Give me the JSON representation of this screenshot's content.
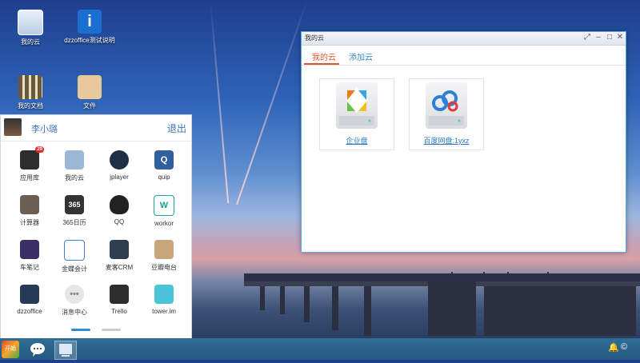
{
  "desktop_icons": [
    {
      "label": "我的云",
      "icon": "cloud-icon"
    },
    {
      "label": "dzzoffice测试说明",
      "icon": "info-icon"
    },
    {
      "label": "我的文档",
      "icon": "library-books-icon"
    },
    {
      "label": "文件",
      "icon": "folder-icon"
    }
  ],
  "start_menu": {
    "username": "李小璐",
    "logout": "退出",
    "apps": [
      {
        "label": "应用库",
        "icon": "app-store-icon",
        "color": "#2d2d2d",
        "badge": "29"
      },
      {
        "label": "我的云",
        "icon": "cloud-icon",
        "color": "#9bb7d6"
      },
      {
        "label": "jplayer",
        "icon": "speaker-icon",
        "color": "#1f2f45"
      },
      {
        "label": "quip",
        "icon": "quip-icon",
        "color": "#2f5f9e"
      },
      {
        "label": "计算器",
        "icon": "calculator-icon",
        "color": "#6b5e52"
      },
      {
        "label": "365日历",
        "icon": "calendar-icon",
        "color": "#333333"
      },
      {
        "label": "QQ",
        "icon": "penguin-icon",
        "color": "#222222"
      },
      {
        "label": "workor",
        "icon": "workor-icon",
        "color": "#1aa39a"
      },
      {
        "label": "车笔记",
        "icon": "notebook-icon",
        "color": "#3b2f66"
      },
      {
        "label": "金蝶会计",
        "icon": "kingdee-icon",
        "color": "#3d7fd4"
      },
      {
        "label": "麦客CRM",
        "icon": "crm-icon",
        "color": "#2c3e50"
      },
      {
        "label": "豆瓣电台",
        "icon": "radio-icon",
        "color": "#c9a57a"
      },
      {
        "label": "dzzoffice",
        "icon": "dzzoffice-icon",
        "color": "#253a55"
      },
      {
        "label": "消息中心",
        "icon": "message-icon",
        "color": "#e6e6e6"
      },
      {
        "label": "Trello",
        "icon": "trello-icon",
        "color": "#2d2d2d"
      },
      {
        "label": "tower.im",
        "icon": "tower-icon",
        "color": "#4cc3d9"
      }
    ]
  },
  "window": {
    "title": "我的云",
    "tabs": [
      "我的云",
      "添加云"
    ],
    "cards": [
      "企业盘",
      "百度网盘:1yxz"
    ]
  },
  "taskbar": {
    "start_label": "开始"
  }
}
